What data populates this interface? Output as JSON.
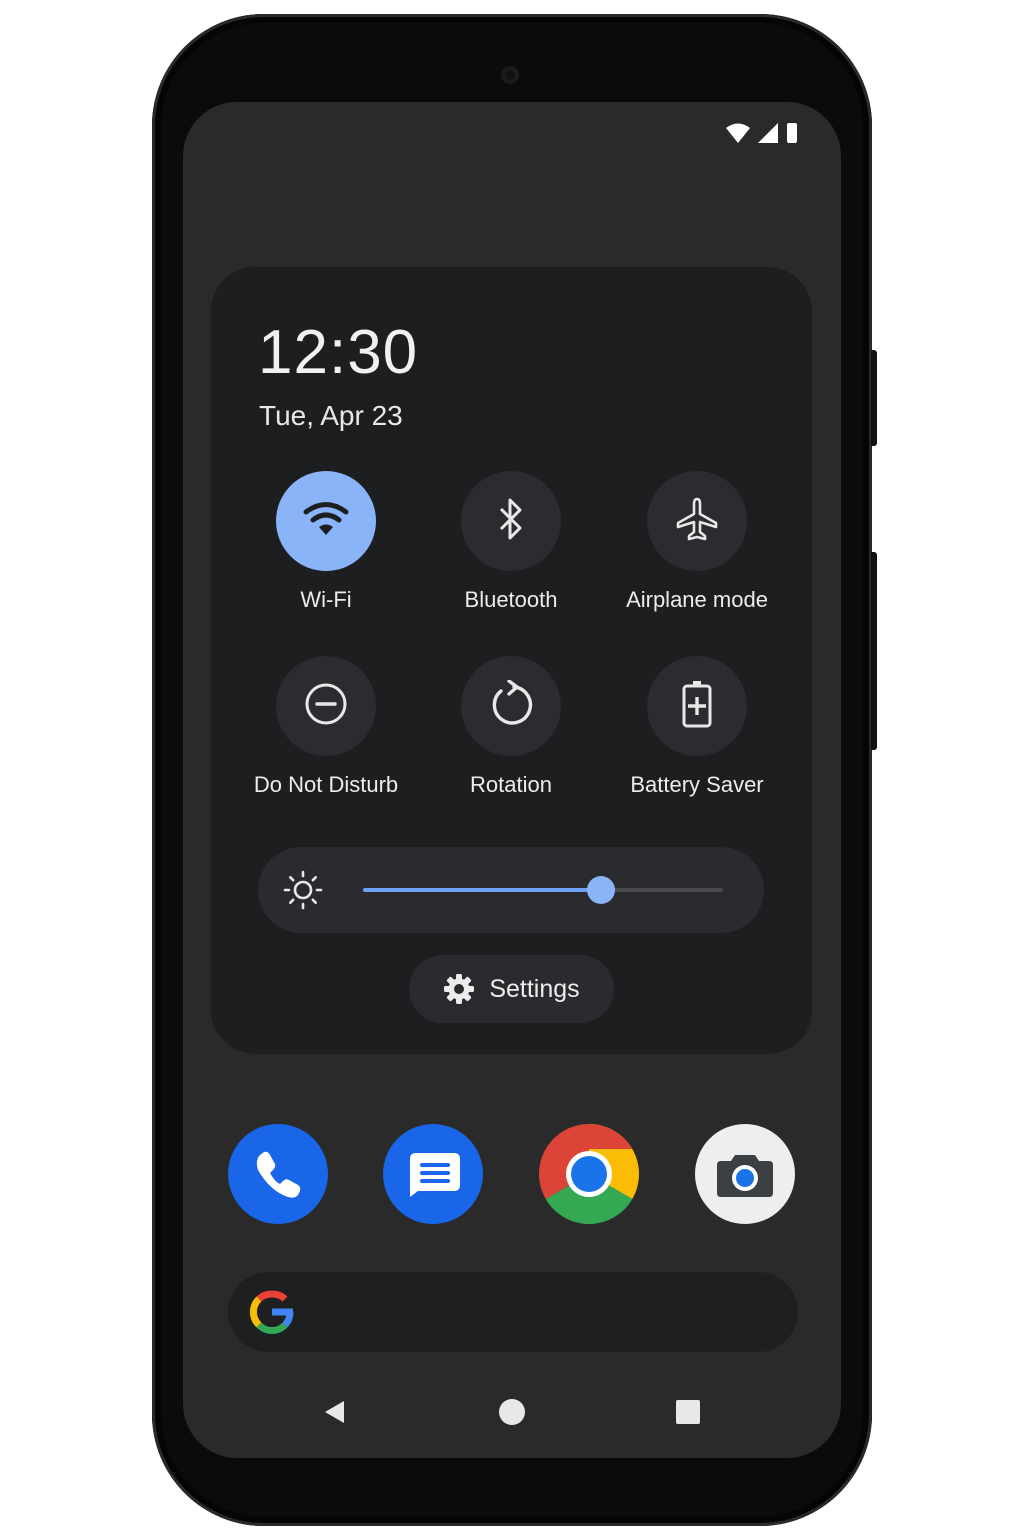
{
  "status_bar": {
    "icons": [
      "wifi-icon",
      "cellular-signal-icon",
      "battery-icon"
    ]
  },
  "quick_settings": {
    "time": "12:30",
    "date": "Tue, Apr 23",
    "tiles": [
      {
        "label": "Wi-Fi",
        "icon": "wifi-icon",
        "active": true
      },
      {
        "label": "Bluetooth",
        "icon": "bluetooth-icon",
        "active": false
      },
      {
        "label": "Airplane mode",
        "icon": "airplane-icon",
        "active": false
      },
      {
        "label": "Do Not Disturb",
        "icon": "do-not-disturb-icon",
        "active": false
      },
      {
        "label": "Rotation",
        "icon": "rotation-icon",
        "active": false
      },
      {
        "label": "Battery Saver",
        "icon": "battery-saver-icon",
        "active": false
      }
    ],
    "brightness": {
      "icon": "brightness-icon",
      "level": 0.66
    },
    "settings_button": {
      "label": "Settings",
      "icon": "gear-icon"
    }
  },
  "dock": {
    "apps": [
      {
        "name": "Phone",
        "icon": "phone-icon",
        "color": "#1a66e8"
      },
      {
        "name": "Messages",
        "icon": "messages-icon",
        "color": "#1a66e8"
      },
      {
        "name": "Chrome",
        "icon": "chrome-icon",
        "color": "#db4437"
      },
      {
        "name": "Camera",
        "icon": "camera-icon",
        "color": "#eeeeee"
      }
    ]
  },
  "search_bar": {
    "icon": "google-logo-icon"
  },
  "navigation": {
    "buttons": [
      "back-button",
      "home-button",
      "recents-button"
    ]
  },
  "theme": {
    "accent": "#8ab4f8",
    "panel_bg": "#1d1e20",
    "screen_bg": "#2a2a2a"
  }
}
